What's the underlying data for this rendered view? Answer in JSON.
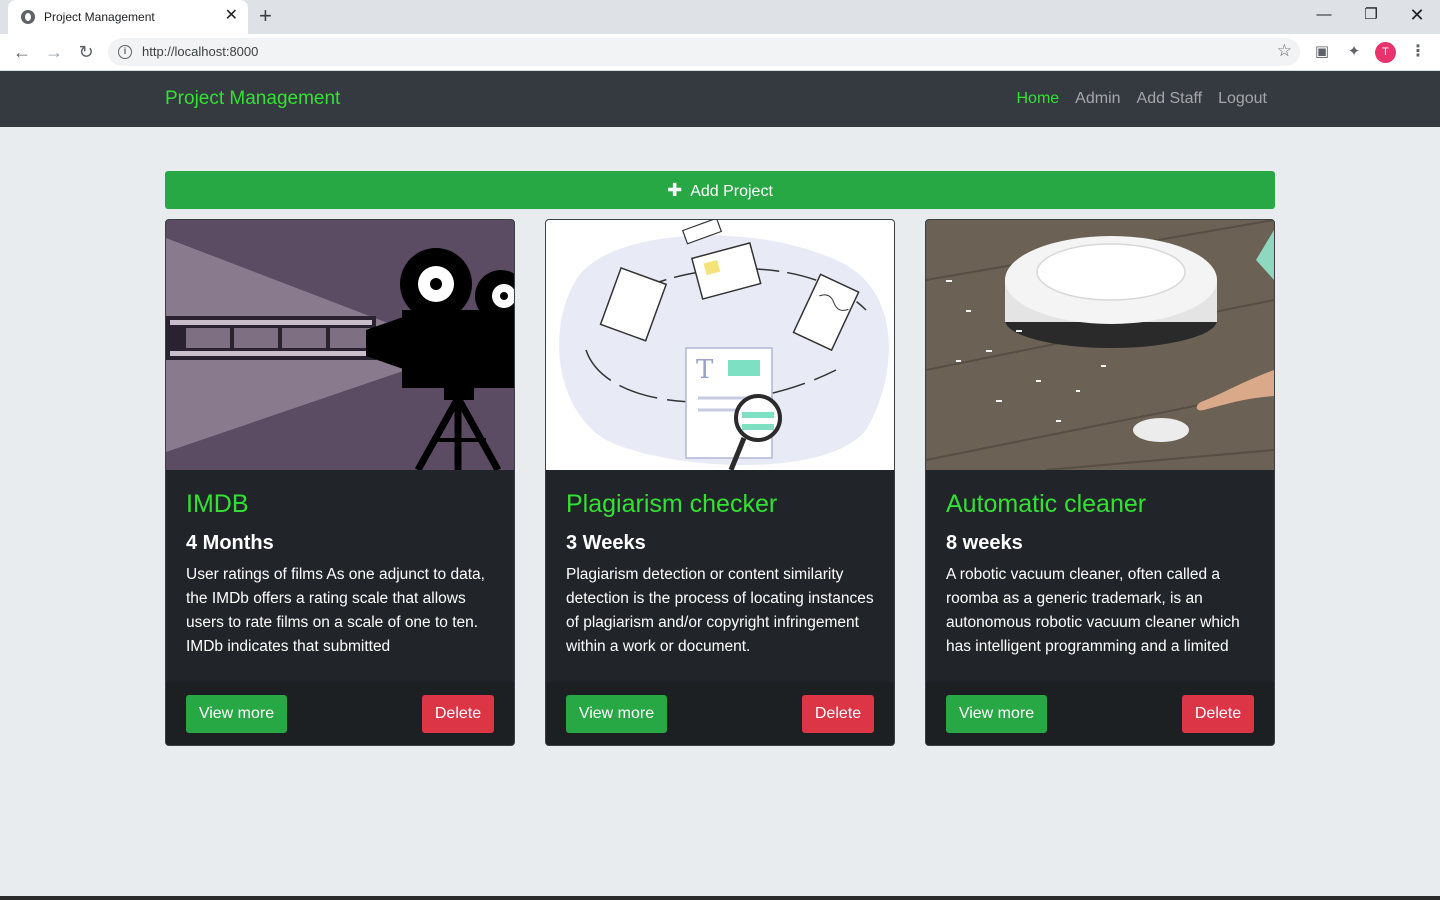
{
  "browser": {
    "tab_title": "Project Management",
    "tab_close": "✕",
    "new_tab": "+",
    "url": "http://localhost:8000",
    "profile_initial": "T",
    "window_minimize": "—",
    "window_restore": "❐",
    "window_close": "✕"
  },
  "navbar": {
    "brand": "Project Management",
    "links": [
      {
        "label": "Home",
        "active": true
      },
      {
        "label": "Admin",
        "active": false
      },
      {
        "label": "Add Staff",
        "active": false
      },
      {
        "label": "Logout",
        "active": false
      }
    ]
  },
  "main": {
    "add_project_label": "Add Project",
    "cards": [
      {
        "title": "IMDB",
        "duration": "4 Months",
        "description": "User ratings of films As one adjunct to data, the IMDb offers a rating scale that allows users to rate films on a scale of one to ten. IMDb indicates that submitted",
        "view_label": "View more",
        "delete_label": "Delete"
      },
      {
        "title": "Plagiarism checker",
        "duration": "3 Weeks",
        "description": "Plagiarism detection or content similarity detection is the process of locating instances of plagiarism and/or copyright infringement within a work or document.",
        "view_label": "View more",
        "delete_label": "Delete"
      },
      {
        "title": "Automatic cleaner",
        "duration": "8 weeks",
        "description": "A robotic vacuum cleaner, often called a roomba as a generic trademark, is an autonomous robotic vacuum cleaner which has intelligent programming and a limited",
        "view_label": "View more",
        "delete_label": "Delete"
      }
    ]
  },
  "colors": {
    "brand_green": "#32e232",
    "success": "#28a745",
    "danger": "#dc3545",
    "navbar": "#343a40",
    "card_bg": "#212529",
    "page_bg": "#e9ecef"
  }
}
